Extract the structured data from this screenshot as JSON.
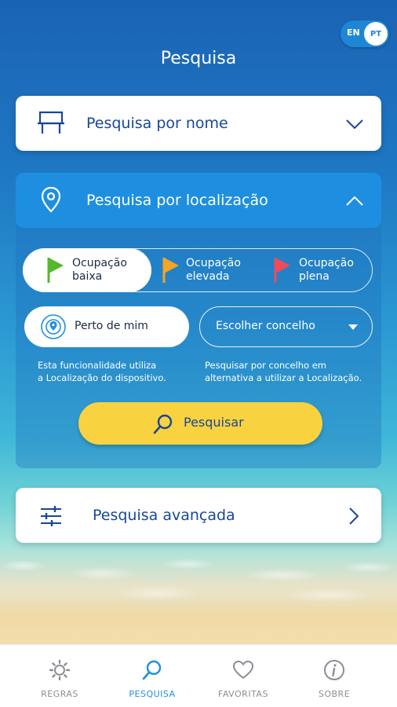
{
  "language": {
    "en": "EN",
    "pt": "PT",
    "selected": "PT"
  },
  "header": {
    "title": "Pesquisa"
  },
  "search_by_name": {
    "label": "Pesquisa por nome",
    "icon": "bench-icon",
    "expanded": false
  },
  "search_by_location": {
    "label": "Pesquisa por localização",
    "icon": "location-pin-icon",
    "expanded": true,
    "occupancy": [
      {
        "line1": "Ocupação",
        "line2": "baixa",
        "color": "#55b82e",
        "selected": true
      },
      {
        "line1": "Ocupação",
        "line2": "elevada",
        "color": "#f4a622",
        "selected": false
      },
      {
        "line1": "Ocupação",
        "line2": "plena",
        "color": "#ef4b5b",
        "selected": false
      }
    ],
    "near_me": {
      "label": "Perto de mim",
      "help_line1": "Esta funcionalidade utiliza",
      "help_line2": "a Localização do dispositivo."
    },
    "municipality": {
      "label": "Escolher concelho",
      "help_line1": "Pesquisar por concelho em",
      "help_line2": "alternativa a utilizar a Localização."
    },
    "search_button": "Pesquisar"
  },
  "advanced_search": {
    "label": "Pesquisa avançada",
    "icon": "sliders-icon"
  },
  "nav": [
    {
      "label": "REGRAS",
      "icon": "gear-icon",
      "active": false
    },
    {
      "label": "PESQUISA",
      "icon": "search-icon",
      "active": true
    },
    {
      "label": "FAVORITAS",
      "icon": "heart-icon",
      "active": false
    },
    {
      "label": "SOBRE",
      "icon": "info-icon",
      "active": false
    }
  ],
  "colors": {
    "primary": "#17479b",
    "accent": "#1e8fe0",
    "button": "#f9d23f"
  }
}
